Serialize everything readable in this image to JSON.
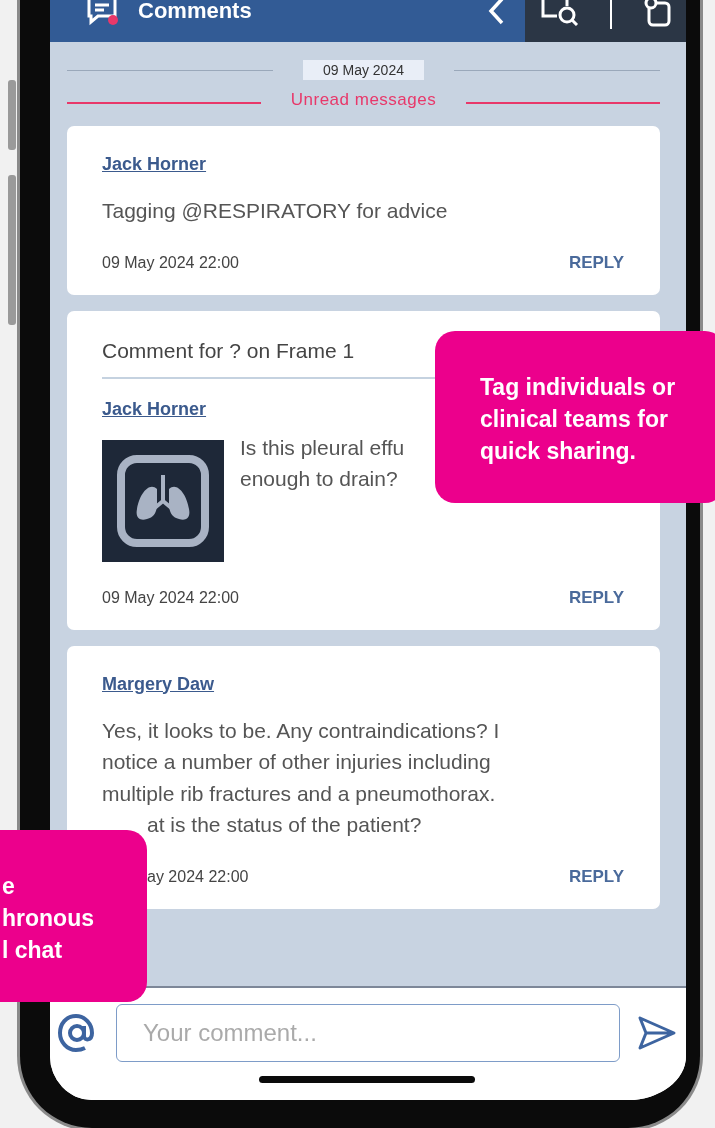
{
  "header": {
    "title": "Comments"
  },
  "date_divider": "09 May 2024",
  "unread_divider": "Unread messages",
  "comments": [
    {
      "kind": "plain",
      "author": "Jack Horner",
      "text_parts": [
        "Tagging @RESPIRATORY for advice"
      ],
      "time": "09 May 2024 22:00",
      "action": "REPLY"
    },
    {
      "kind": "frame",
      "context": "Comment for ? on Frame 1",
      "author": "Jack Horner",
      "text_parts": [
        "Is this pleural effu\nenough to drain?"
      ],
      "time": "09 May 2024 22:00",
      "action": "REPLY"
    },
    {
      "kind": "overlaid",
      "author": "Margery Daw",
      "text_parts": [
        "Yes, it looks to be. Any contraindications? I\nnotice a number of other injuries including\nmultiple rib fractures and a pneumothorax.",
        "at is the status of the patient?"
      ],
      "time": "ay 2024 22:00",
      "action": "REPLY"
    }
  ],
  "composer": {
    "placeholder": "Your comment..."
  },
  "callouts": [
    {
      "text": "Tag individuals or clinical teams for quick sharing."
    },
    {
      "text": "e\nhronous\nl chat"
    }
  ]
}
